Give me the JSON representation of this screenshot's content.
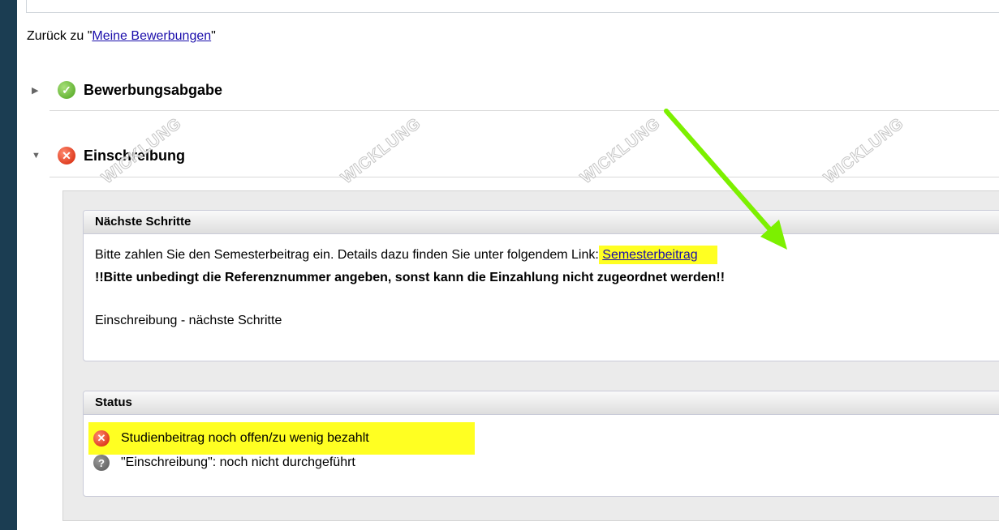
{
  "back": {
    "prefix": "Zurück zu \"",
    "link": "Meine Bewerbungen",
    "suffix": "\""
  },
  "sections": [
    {
      "title": "Bewerbungsabgabe",
      "status": "ok"
    },
    {
      "title": "Einschreibung",
      "status": "error"
    }
  ],
  "next_steps": {
    "header": "Nächste Schritte",
    "text": "Bitte zahlen Sie den Semesterbeitrag ein. Details dazu finden Sie unter folgendem Link: ",
    "link": "Semesterbeitrag",
    "warning": "!!Bitte unbedingt die Referenznummer angeben, sonst kann die Einzahlung nicht zugeordnet werden!!",
    "footer": "Einschreibung - nächste Schritte"
  },
  "status": {
    "header": "Status",
    "items": [
      {
        "text": "Studienbeitrag noch offen/zu wenig bezahlt",
        "icon": "error-icon"
      },
      {
        "text": "\"Einschreibung\": noch nicht durchgeführt",
        "icon": "question-icon"
      }
    ]
  },
  "watermark": "WICKLUNG",
  "colors": {
    "highlight": "#ffff22",
    "arrow": "#7cf000",
    "link": "#1a0dab"
  }
}
